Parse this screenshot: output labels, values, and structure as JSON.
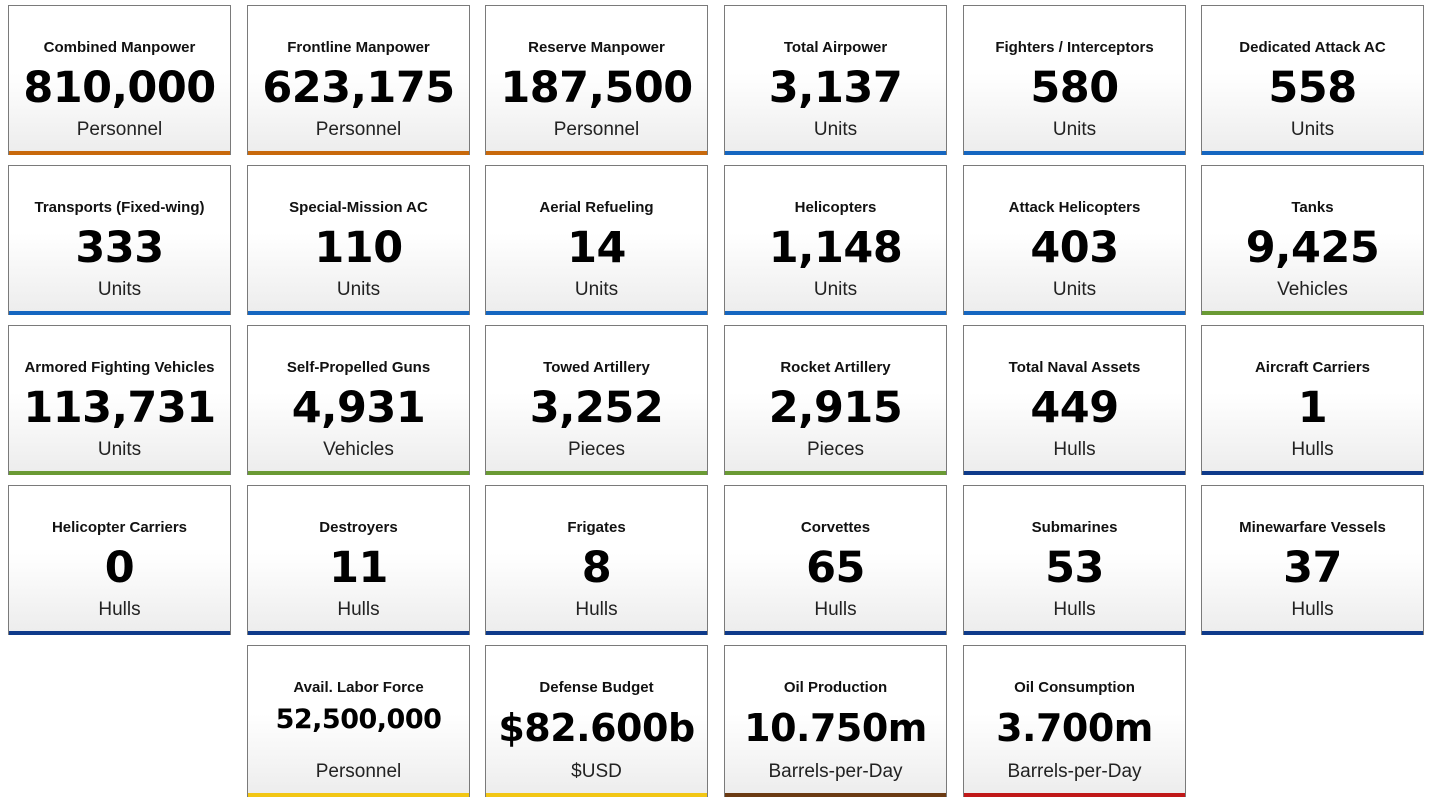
{
  "colors": {
    "manpower": "#c8690c",
    "air": "#1566c0",
    "land": "#6a9a34",
    "naval": "#0e3a8a",
    "resources": "#f2c614",
    "oil_production": "#6b3a12",
    "oil_consumption": "#c01818"
  },
  "rows": [
    [
      {
        "title": "Combined Manpower",
        "value": "810,000",
        "unit": "Personnel",
        "color": "manpower"
      },
      {
        "title": "Frontline Manpower",
        "value": "623,175",
        "unit": "Personnel",
        "color": "manpower"
      },
      {
        "title": "Reserve Manpower",
        "value": "187,500",
        "unit": "Personnel",
        "color": "manpower"
      },
      {
        "title": "Total Airpower",
        "value": "3,137",
        "unit": "Units",
        "color": "air"
      },
      {
        "title": "Fighters / Interceptors",
        "value": "580",
        "unit": "Units",
        "color": "air"
      },
      {
        "title": "Dedicated Attack AC",
        "value": "558",
        "unit": "Units",
        "color": "air"
      }
    ],
    [
      {
        "title": "Transports (Fixed-wing)",
        "value": "333",
        "unit": "Units",
        "color": "air"
      },
      {
        "title": "Special-Mission AC",
        "value": "110",
        "unit": "Units",
        "color": "air"
      },
      {
        "title": "Aerial Refueling",
        "value": "14",
        "unit": "Units",
        "color": "air"
      },
      {
        "title": "Helicopters",
        "value": "1,148",
        "unit": "Units",
        "color": "air"
      },
      {
        "title": "Attack Helicopters",
        "value": "403",
        "unit": "Units",
        "color": "air"
      },
      {
        "title": "Tanks",
        "value": "9,425",
        "unit": "Vehicles",
        "color": "land"
      }
    ],
    [
      {
        "title": "Armored Fighting Vehicles",
        "value": "113,731",
        "unit": "Units",
        "color": "land"
      },
      {
        "title": "Self-Propelled Guns",
        "value": "4,931",
        "unit": "Vehicles",
        "color": "land"
      },
      {
        "title": "Towed Artillery",
        "value": "3,252",
        "unit": "Pieces",
        "color": "land"
      },
      {
        "title": "Rocket Artillery",
        "value": "2,915",
        "unit": "Pieces",
        "color": "land"
      },
      {
        "title": "Total Naval Assets",
        "value": "449",
        "unit": "Hulls",
        "color": "naval"
      },
      {
        "title": "Aircraft Carriers",
        "value": "1",
        "unit": "Hulls",
        "color": "naval"
      }
    ],
    [
      {
        "title": "Helicopter Carriers",
        "value": "0",
        "unit": "Hulls",
        "color": "naval"
      },
      {
        "title": "Destroyers",
        "value": "11",
        "unit": "Hulls",
        "color": "naval"
      },
      {
        "title": "Frigates",
        "value": "8",
        "unit": "Hulls",
        "color": "naval"
      },
      {
        "title": "Corvettes",
        "value": "65",
        "unit": "Hulls",
        "color": "naval"
      },
      {
        "title": "Submarines",
        "value": "53",
        "unit": "Hulls",
        "color": "naval"
      },
      {
        "title": "Minewarfare Vessels",
        "value": "37",
        "unit": "Hulls",
        "color": "naval"
      }
    ]
  ],
  "last_row": [
    {
      "title": "Avail. Labor Force",
      "value": "52,500,000",
      "unit": "Personnel",
      "color": "resources",
      "size": "small"
    },
    {
      "title": "Defense Budget",
      "value": "$82.600b",
      "unit": "$USD",
      "color": "resources",
      "size": "mid"
    },
    {
      "title": "Oil Production",
      "value": "10.750m",
      "unit": "Barrels-per-Day",
      "color": "oil_production",
      "size": "mid"
    },
    {
      "title": "Oil Consumption",
      "value": "3.700m",
      "unit": "Barrels-per-Day",
      "color": "oil_consumption",
      "size": "mid"
    }
  ]
}
